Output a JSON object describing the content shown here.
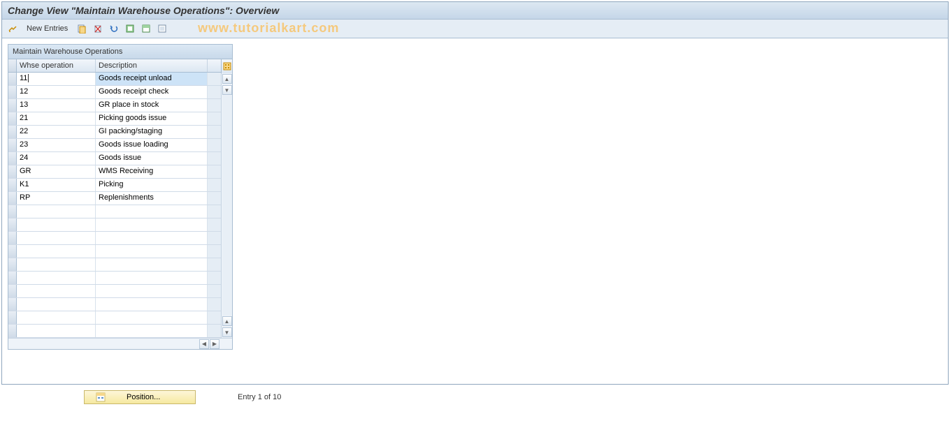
{
  "window_title": "Change View \"Maintain Warehouse Operations\": Overview",
  "toolbar": {
    "new_entries_label": "New Entries"
  },
  "watermark": "www.tutorialkart.com",
  "grid": {
    "title": "Maintain Warehouse Operations",
    "columns": {
      "op": "Whse operation",
      "desc": "Description"
    },
    "rows": [
      {
        "op": "11",
        "desc": "Goods receipt unload",
        "selected": true
      },
      {
        "op": "12",
        "desc": "Goods receipt check"
      },
      {
        "op": "13",
        "desc": "GR place in stock"
      },
      {
        "op": "21",
        "desc": "Picking goods issue"
      },
      {
        "op": "22",
        "desc": "GI packing/staging"
      },
      {
        "op": "23",
        "desc": "Goods issue loading"
      },
      {
        "op": "24",
        "desc": "Goods issue"
      },
      {
        "op": "GR",
        "desc": "WMS Receiving"
      },
      {
        "op": "K1",
        "desc": "Picking"
      },
      {
        "op": "RP",
        "desc": "Replenishments"
      },
      {
        "op": "",
        "desc": ""
      },
      {
        "op": "",
        "desc": ""
      },
      {
        "op": "",
        "desc": ""
      },
      {
        "op": "",
        "desc": ""
      },
      {
        "op": "",
        "desc": ""
      },
      {
        "op": "",
        "desc": ""
      },
      {
        "op": "",
        "desc": ""
      },
      {
        "op": "",
        "desc": ""
      },
      {
        "op": "",
        "desc": ""
      },
      {
        "op": "",
        "desc": ""
      }
    ]
  },
  "footer": {
    "position_label": "Position...",
    "entry_text": "Entry 1 of 10"
  }
}
